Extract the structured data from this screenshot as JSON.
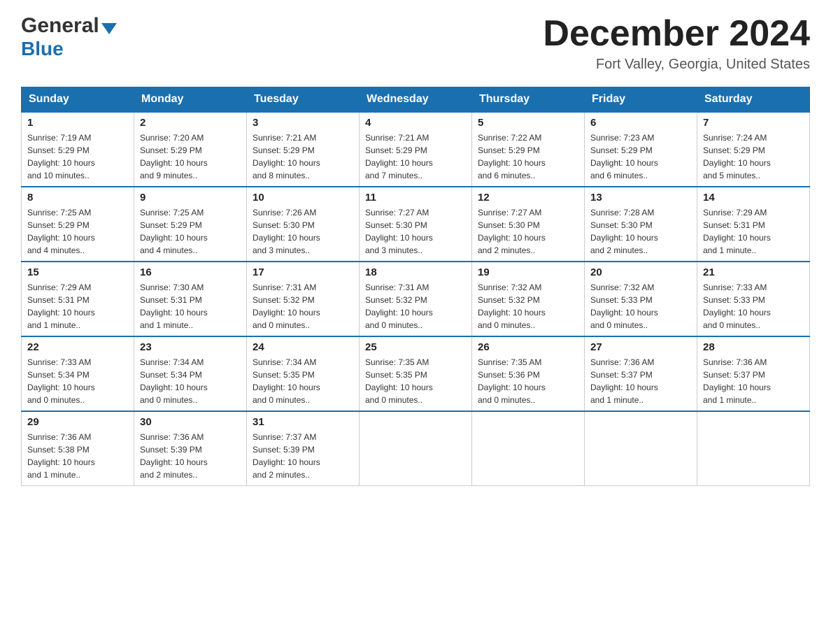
{
  "header": {
    "logo_general": "General",
    "logo_blue": "Blue",
    "month_title": "December 2024",
    "location": "Fort Valley, Georgia, United States"
  },
  "days_of_week": [
    "Sunday",
    "Monday",
    "Tuesday",
    "Wednesday",
    "Thursday",
    "Friday",
    "Saturday"
  ],
  "weeks": [
    [
      {
        "day": "1",
        "sunrise": "7:19 AM",
        "sunset": "5:29 PM",
        "daylight": "10 hours and 10 minutes."
      },
      {
        "day": "2",
        "sunrise": "7:20 AM",
        "sunset": "5:29 PM",
        "daylight": "10 hours and 9 minutes."
      },
      {
        "day": "3",
        "sunrise": "7:21 AM",
        "sunset": "5:29 PM",
        "daylight": "10 hours and 8 minutes."
      },
      {
        "day": "4",
        "sunrise": "7:21 AM",
        "sunset": "5:29 PM",
        "daylight": "10 hours and 7 minutes."
      },
      {
        "day": "5",
        "sunrise": "7:22 AM",
        "sunset": "5:29 PM",
        "daylight": "10 hours and 6 minutes."
      },
      {
        "day": "6",
        "sunrise": "7:23 AM",
        "sunset": "5:29 PM",
        "daylight": "10 hours and 6 minutes."
      },
      {
        "day": "7",
        "sunrise": "7:24 AM",
        "sunset": "5:29 PM",
        "daylight": "10 hours and 5 minutes."
      }
    ],
    [
      {
        "day": "8",
        "sunrise": "7:25 AM",
        "sunset": "5:29 PM",
        "daylight": "10 hours and 4 minutes."
      },
      {
        "day": "9",
        "sunrise": "7:25 AM",
        "sunset": "5:29 PM",
        "daylight": "10 hours and 4 minutes."
      },
      {
        "day": "10",
        "sunrise": "7:26 AM",
        "sunset": "5:30 PM",
        "daylight": "10 hours and 3 minutes."
      },
      {
        "day": "11",
        "sunrise": "7:27 AM",
        "sunset": "5:30 PM",
        "daylight": "10 hours and 3 minutes."
      },
      {
        "day": "12",
        "sunrise": "7:27 AM",
        "sunset": "5:30 PM",
        "daylight": "10 hours and 2 minutes."
      },
      {
        "day": "13",
        "sunrise": "7:28 AM",
        "sunset": "5:30 PM",
        "daylight": "10 hours and 2 minutes."
      },
      {
        "day": "14",
        "sunrise": "7:29 AM",
        "sunset": "5:31 PM",
        "daylight": "10 hours and 1 minute."
      }
    ],
    [
      {
        "day": "15",
        "sunrise": "7:29 AM",
        "sunset": "5:31 PM",
        "daylight": "10 hours and 1 minute."
      },
      {
        "day": "16",
        "sunrise": "7:30 AM",
        "sunset": "5:31 PM",
        "daylight": "10 hours and 1 minute."
      },
      {
        "day": "17",
        "sunrise": "7:31 AM",
        "sunset": "5:32 PM",
        "daylight": "10 hours and 0 minutes."
      },
      {
        "day": "18",
        "sunrise": "7:31 AM",
        "sunset": "5:32 PM",
        "daylight": "10 hours and 0 minutes."
      },
      {
        "day": "19",
        "sunrise": "7:32 AM",
        "sunset": "5:32 PM",
        "daylight": "10 hours and 0 minutes."
      },
      {
        "day": "20",
        "sunrise": "7:32 AM",
        "sunset": "5:33 PM",
        "daylight": "10 hours and 0 minutes."
      },
      {
        "day": "21",
        "sunrise": "7:33 AM",
        "sunset": "5:33 PM",
        "daylight": "10 hours and 0 minutes."
      }
    ],
    [
      {
        "day": "22",
        "sunrise": "7:33 AM",
        "sunset": "5:34 PM",
        "daylight": "10 hours and 0 minutes."
      },
      {
        "day": "23",
        "sunrise": "7:34 AM",
        "sunset": "5:34 PM",
        "daylight": "10 hours and 0 minutes."
      },
      {
        "day": "24",
        "sunrise": "7:34 AM",
        "sunset": "5:35 PM",
        "daylight": "10 hours and 0 minutes."
      },
      {
        "day": "25",
        "sunrise": "7:35 AM",
        "sunset": "5:35 PM",
        "daylight": "10 hours and 0 minutes."
      },
      {
        "day": "26",
        "sunrise": "7:35 AM",
        "sunset": "5:36 PM",
        "daylight": "10 hours and 0 minutes."
      },
      {
        "day": "27",
        "sunrise": "7:36 AM",
        "sunset": "5:37 PM",
        "daylight": "10 hours and 1 minute."
      },
      {
        "day": "28",
        "sunrise": "7:36 AM",
        "sunset": "5:37 PM",
        "daylight": "10 hours and 1 minute."
      }
    ],
    [
      {
        "day": "29",
        "sunrise": "7:36 AM",
        "sunset": "5:38 PM",
        "daylight": "10 hours and 1 minute."
      },
      {
        "day": "30",
        "sunrise": "7:36 AM",
        "sunset": "5:39 PM",
        "daylight": "10 hours and 2 minutes."
      },
      {
        "day": "31",
        "sunrise": "7:37 AM",
        "sunset": "5:39 PM",
        "daylight": "10 hours and 2 minutes."
      },
      null,
      null,
      null,
      null
    ]
  ],
  "labels": {
    "sunrise": "Sunrise:",
    "sunset": "Sunset:",
    "daylight": "Daylight:"
  }
}
